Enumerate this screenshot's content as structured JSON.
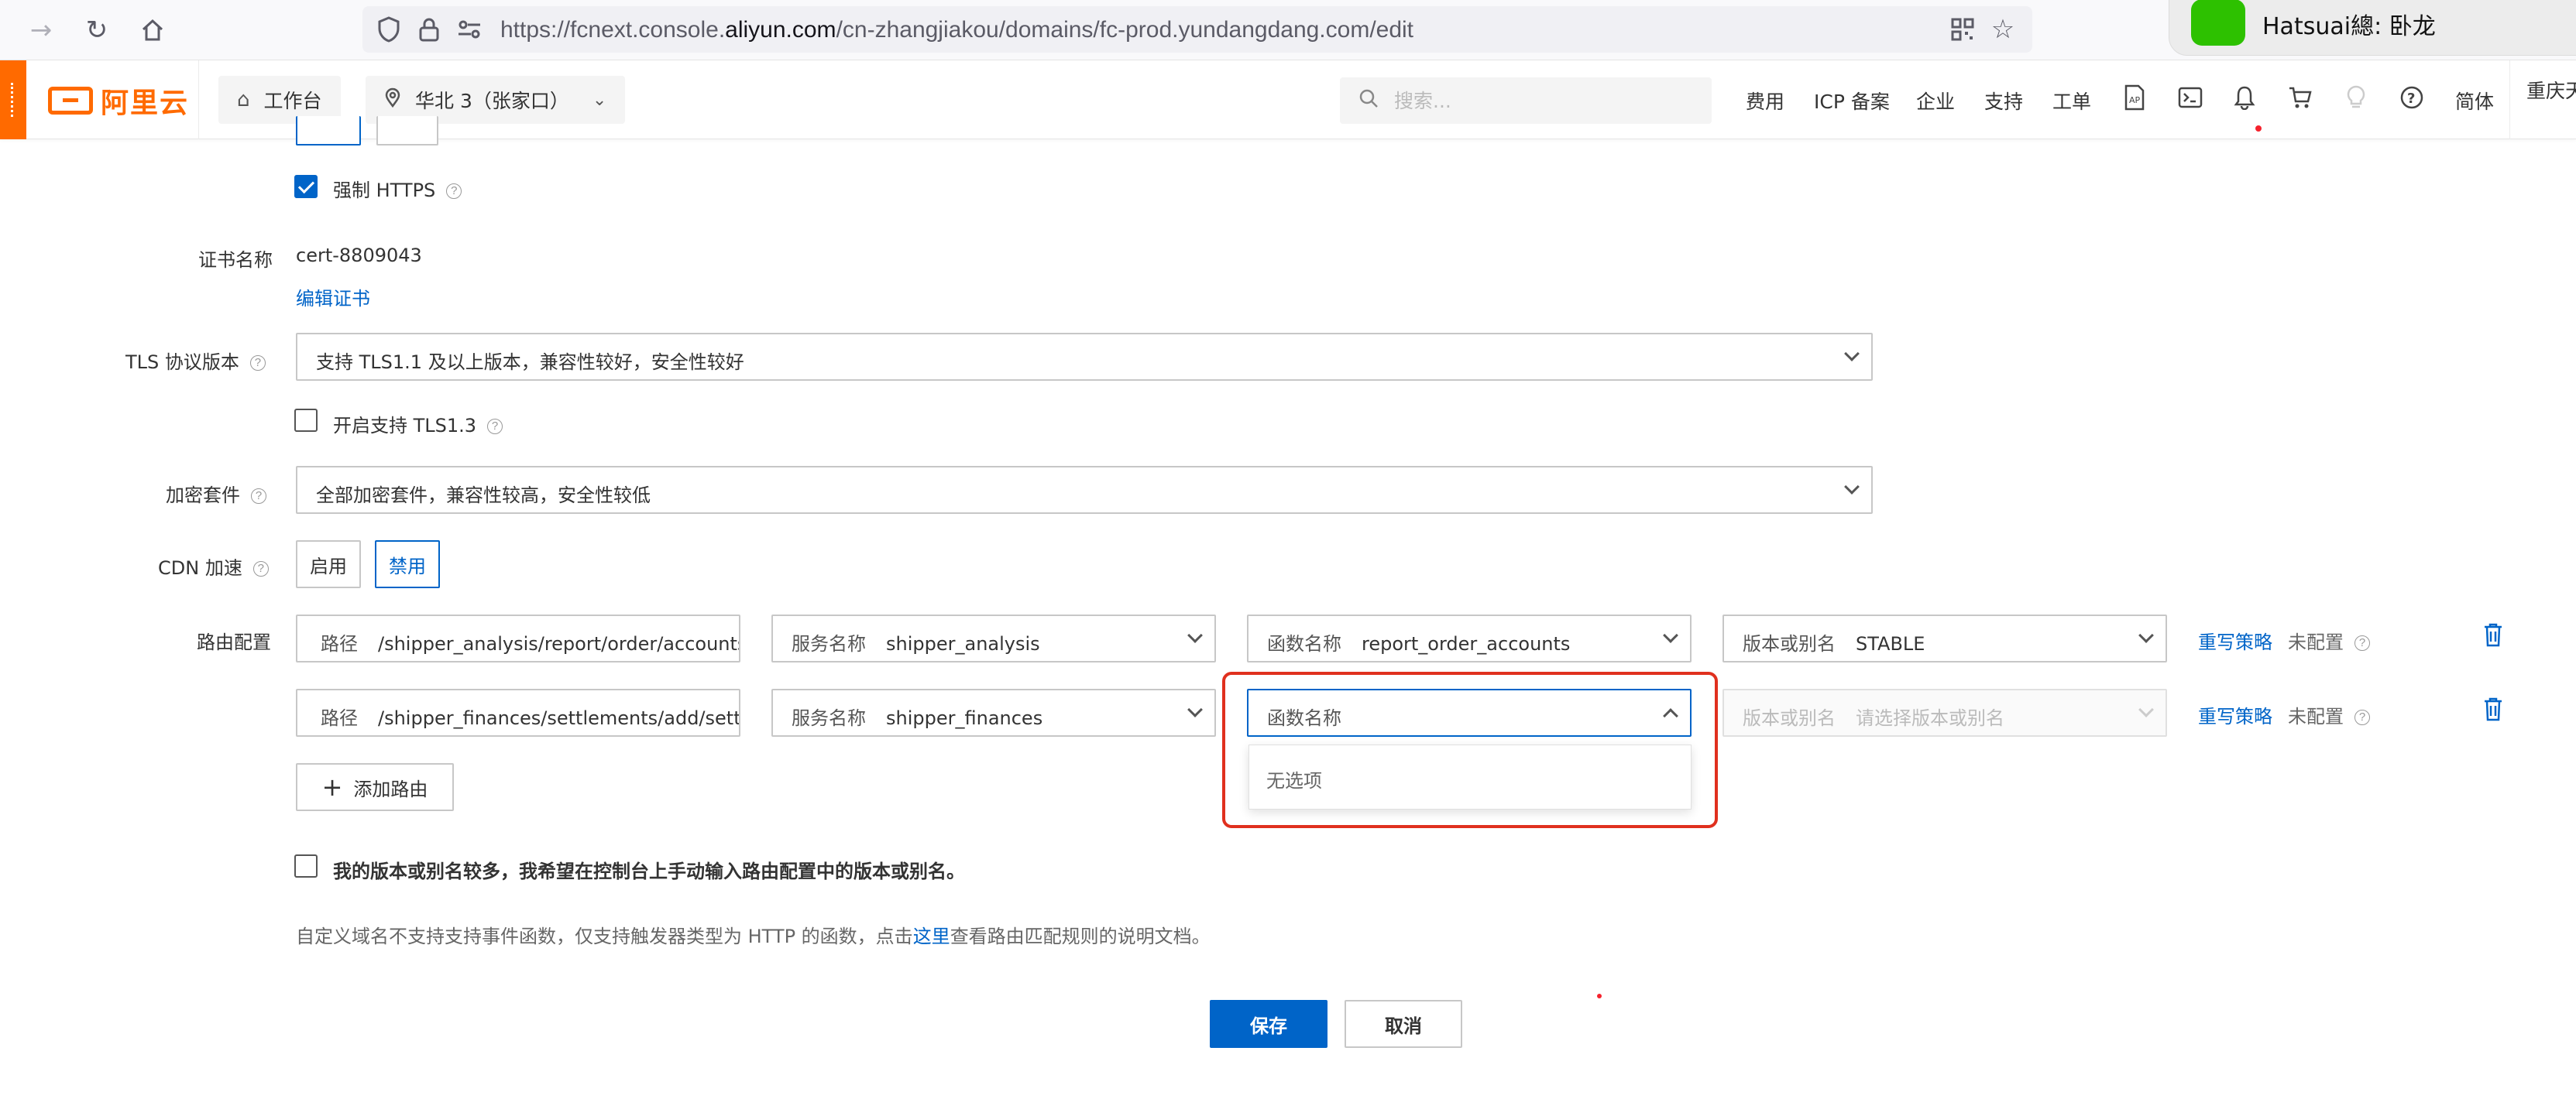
{
  "browser": {
    "url_prefix": "https://fcnext.console.",
    "url_domain": "aliyun.com",
    "url_path": "/cn-zhangjiakou/domains/fc-prod.yundangdang.com/edit",
    "notification_text": "Hatsuai總: 卧龙"
  },
  "header": {
    "logo_text": "阿里云",
    "workbench_label": "工作台",
    "region_label": "华北 3（张家口）",
    "search_placeholder": "搜索...",
    "links": {
      "fees": "费用",
      "icp": "ICP 备案",
      "enterprise": "企业",
      "support": "支持",
      "tickets": "工单",
      "language": "简体",
      "user": "重庆天"
    }
  },
  "form": {
    "force_https_label": "强制 HTTPS",
    "force_https_checked": true,
    "cert_name_label": "证书名称",
    "cert_name_value": "cert-8809043",
    "edit_cert_link": "编辑证书",
    "tls_label": "TLS 协议版本",
    "tls_value": "支持 TLS1.1 及以上版本，兼容性较好，安全性较好",
    "tls13_label": "开启支持 TLS1.3",
    "tls13_checked": false,
    "cipher_label": "加密套件",
    "cipher_value": "全部加密套件，兼容性较高，安全性较低",
    "cdn_label": "CDN 加速",
    "cdn_enable": "启用",
    "cdn_disable": "禁用",
    "cdn_selected": "disable",
    "route_label": "路由配置",
    "routes": [
      {
        "path_prefix": "路径",
        "path": "/shipper_analysis/report/order/accounts",
        "service_prefix": "服务名称",
        "service": "shipper_analysis",
        "function_prefix": "函数名称",
        "function": "report_order_accounts",
        "version_prefix": "版本或别名",
        "version": "STABLE",
        "rewrite_link": "重写策略",
        "rewrite_status": "未配置"
      },
      {
        "path_prefix": "路径",
        "path": "/shipper_finances/settlements/add/settlement",
        "service_prefix": "服务名称",
        "service": "shipper_finances",
        "function_prefix": "函数名称",
        "function": "",
        "version_prefix": "版本或别名",
        "version": "请选择版本或别名",
        "rewrite_link": "重写策略",
        "rewrite_status": "未配置"
      }
    ],
    "dropdown_empty": "无选项",
    "add_route_label": "添加路由",
    "manual_version_label": "我的版本或别名较多，我希望在控制台上手动输入路由配置中的版本或别名。",
    "manual_version_checked": false,
    "note_before": "自定义域名不支持支持事件函数，仅支持触发器类型为 HTTP 的函数，点击",
    "note_link": "这里",
    "note_after": "查看路由匹配规则的说明文档。",
    "save_label": "保存",
    "cancel_label": "取消"
  },
  "colors": {
    "accent": "#0064c8",
    "brand": "#ff6a00",
    "highlight": "#e0301e"
  }
}
